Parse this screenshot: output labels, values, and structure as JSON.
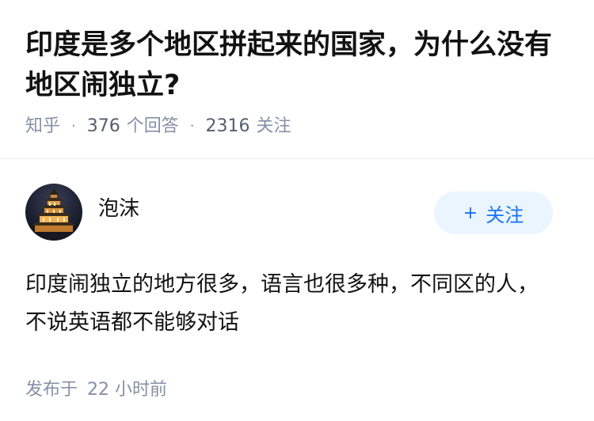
{
  "question": {
    "title": "印度是多个地区拼起来的国家，为什么没有地区闹独立?",
    "source": "知乎",
    "separator": "·",
    "answers_count": "376",
    "answers_label": "个回答",
    "followers_count": "2316",
    "followers_label": "关注"
  },
  "answer": {
    "author_name": "泡沫",
    "follow_label": "关注",
    "follow_plus": "+",
    "content": "印度闹独立的地方很多，语言也很多种，不同区的人，不说英语都不能够对话",
    "published_label": "发布于",
    "published_time": "22 小时前",
    "avatar_icon": "pagoda-at-night-avatar"
  },
  "colors": {
    "title": "#121212",
    "meta": "#8590a6",
    "accent": "#1772f6",
    "follow_bg": "#ebf5ff"
  }
}
